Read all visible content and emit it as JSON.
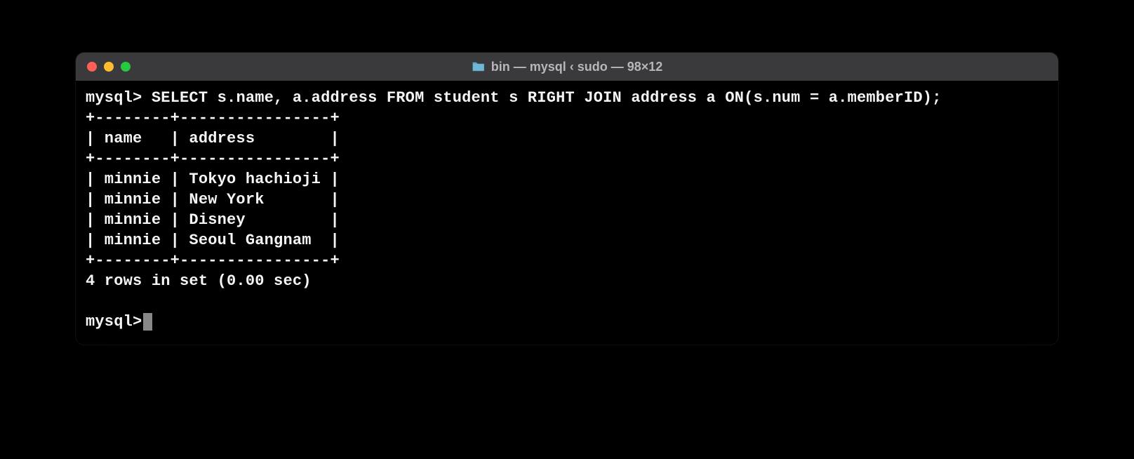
{
  "window": {
    "title": "bin — mysql ‹ sudo — 98×12"
  },
  "terminal": {
    "prompt": "mysql>",
    "query": "SELECT s.name, a.address FROM student s RIGHT JOIN address a ON(s.num = a.memberID);",
    "table_border": "+--------+----------------+",
    "header_row": "| name   | address        |",
    "rows": [
      "| minnie | Tokyo hachioji |",
      "| minnie | New York       |",
      "| minnie | Disney         |",
      "| minnie | Seoul Gangnam  |"
    ],
    "summary": "4 rows in set (0.00 sec)",
    "blank": ""
  }
}
